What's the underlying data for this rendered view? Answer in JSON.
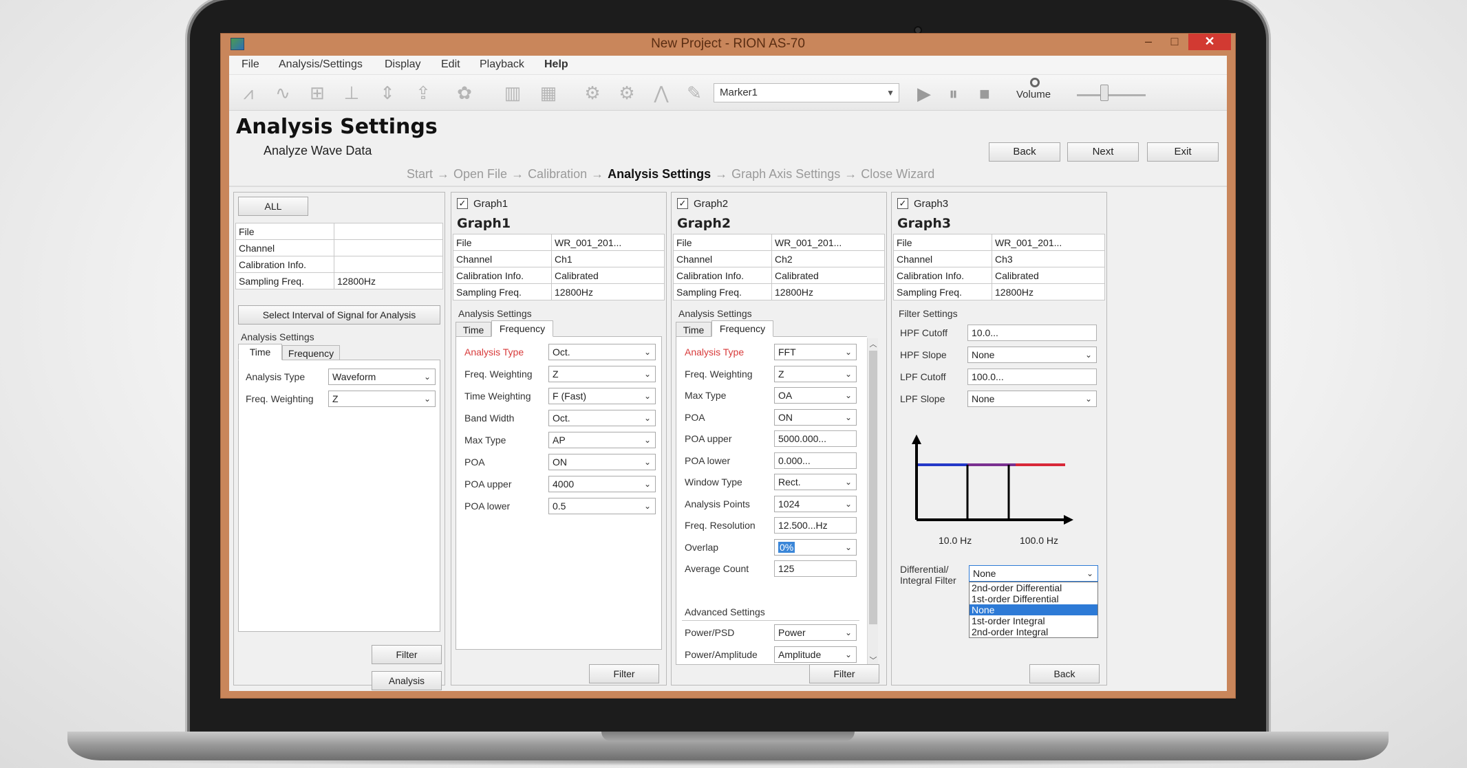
{
  "window": {
    "title": "New Project - RION AS-70",
    "minimize_glyph": "–",
    "maximize_glyph": "□",
    "close_glyph": "✕"
  },
  "menu": {
    "file": "File",
    "analysis_settings": "Analysis/Settings",
    "display": "Display",
    "edit": "Edit",
    "playback": "Playback",
    "help": "Help"
  },
  "toolbar": {
    "marker_value": "Marker1",
    "volume_label": "Volume",
    "volume_level_fraction": 0.4,
    "icons": [
      "spectrum-icon",
      "wave-icon",
      "multi-graph-icon",
      "axis-icon",
      "zoom-fit-icon",
      "export-icon",
      "settings-icon",
      "fft-icon",
      "table-icon",
      "gear-icon",
      "gear-down-icon",
      "peak-icon",
      "pen-icon"
    ]
  },
  "page": {
    "title": "Analysis Settings",
    "subtitle": "Analyze Wave Data",
    "back": "Back",
    "next": "Next",
    "exit": "Exit"
  },
  "breadcrumb": {
    "start": "Start",
    "open_file": "Open File",
    "calibration": "Calibration",
    "analysis_settings": "Analysis Settings",
    "graph_axis_settings": "Graph Axis Settings",
    "close_wizard": "Close Wizard",
    "arrow": "→"
  },
  "all_panel": {
    "all_button": "ALL",
    "rows": [
      {
        "key": "File",
        "value": ""
      },
      {
        "key": "Channel",
        "value": ""
      },
      {
        "key": "Calibration Info.",
        "value": ""
      },
      {
        "key": "Sampling Freq.",
        "value": "12800Hz"
      }
    ],
    "select_interval_button": "Select Interval of Signal for Analysis",
    "analysis_settings_label": "Analysis Settings",
    "tab_time": "Time",
    "tab_frequency": "Frequency",
    "analysis_type_label": "Analysis Type",
    "analysis_type_value": "Waveform",
    "freq_weighting_label": "Freq. Weighting",
    "freq_weighting_value": "Z",
    "filter_button": "Filter",
    "analysis_button": "Analysis"
  },
  "graph1": {
    "checkbox_label": "Graph1",
    "checked_glyph": "✓",
    "title": "Graph1",
    "rows": [
      {
        "key": "File",
        "value": "WR_001_201..."
      },
      {
        "key": "Channel",
        "value": "Ch1"
      },
      {
        "key": "Calibration Info.",
        "value": "Calibrated"
      },
      {
        "key": "Sampling Freq.",
        "value": "12800Hz"
      }
    ],
    "analysis_settings_label": "Analysis Settings",
    "tab_time": "Time",
    "tab_frequency": "Frequency",
    "fields": [
      {
        "label": "Analysis Type",
        "value": "Oct."
      },
      {
        "label": "Freq. Weighting",
        "value": "Z"
      },
      {
        "label": "Time Weighting",
        "value": "F (Fast)"
      },
      {
        "label": "Band Width",
        "value": "Oct."
      },
      {
        "label": "Max Type",
        "value": "AP"
      },
      {
        "label": "POA",
        "value": "ON"
      },
      {
        "label": "POA upper",
        "value": "4000"
      },
      {
        "label": "POA lower",
        "value": "0.5"
      }
    ],
    "filter_button": "Filter"
  },
  "graph2": {
    "checkbox_label": "Graph2",
    "checked_glyph": "✓",
    "title": "Graph2",
    "rows": [
      {
        "key": "File",
        "value": "WR_001_201..."
      },
      {
        "key": "Channel",
        "value": "Ch2"
      },
      {
        "key": "Calibration Info.",
        "value": "Calibrated"
      },
      {
        "key": "Sampling Freq.",
        "value": "12800Hz"
      }
    ],
    "analysis_settings_label": "Analysis Settings",
    "tab_time": "Time",
    "tab_frequency": "Frequency",
    "fields": [
      {
        "label": "Analysis Type",
        "value": "FFT",
        "kind": "dropdown"
      },
      {
        "label": "Freq. Weighting",
        "value": "Z",
        "kind": "dropdown"
      },
      {
        "label": "Max Type",
        "value": "OA",
        "kind": "dropdown"
      },
      {
        "label": "POA",
        "value": "ON",
        "kind": "dropdown"
      },
      {
        "label": "POA upper",
        "value": "5000.000...",
        "kind": "text"
      },
      {
        "label": "POA lower",
        "value": "0.000...",
        "kind": "text"
      },
      {
        "label": "Window Type",
        "value": "Rect.",
        "kind": "dropdown"
      },
      {
        "label": "Analysis Points",
        "value": "1024",
        "kind": "dropdown"
      },
      {
        "label": "Freq. Resolution",
        "value": "12.500...Hz",
        "kind": "text"
      },
      {
        "label": "Overlap",
        "value": "0%",
        "kind": "dropdown"
      },
      {
        "label": "Average Count",
        "value": "125",
        "kind": "text"
      }
    ],
    "advanced_label": "Advanced Settings",
    "power_psd_label": "Power/PSD",
    "power_psd_value": "Power",
    "power_amp_label": "Power/Amplitude",
    "power_amp_value": "Amplitude",
    "filter_button": "Filter"
  },
  "graph3": {
    "checkbox_label": "Graph3",
    "checked_glyph": "✓",
    "title": "Graph3",
    "rows": [
      {
        "key": "File",
        "value": "WR_001_201..."
      },
      {
        "key": "Channel",
        "value": "Ch3"
      },
      {
        "key": "Calibration Info.",
        "value": "Calibrated"
      },
      {
        "key": "Sampling Freq.",
        "value": "12800Hz"
      }
    ],
    "filter_settings_label": "Filter Settings",
    "hpf_cutoff_label": "HPF Cutoff",
    "hpf_cutoff_value": "10.0...",
    "hpf_slope_label": "HPF Slope",
    "hpf_slope_value": "None",
    "lpf_cutoff_label": "LPF Cutoff",
    "lpf_cutoff_value": "100.0...",
    "lpf_slope_label": "LPF Slope",
    "lpf_slope_value": "None",
    "chart_low_label": "10.0 Hz",
    "chart_high_label": "100.0 Hz",
    "diff_label_1": "Differential/",
    "diff_label_2": "Integral Filter",
    "diff_value": "None",
    "diff_options": [
      "2nd-order Differential",
      "1st-order Differential",
      "None",
      "1st-order Integral",
      "2nd-order Integral"
    ],
    "diff_selected_index": 2,
    "back_button": "Back"
  },
  "colors": {
    "frame": "#c9865b",
    "close_red": "#d23a32",
    "required_label": "#d83a3a",
    "filter_blue": "#2438c8",
    "filter_red": "#d82838",
    "selection": "#2d7ad6"
  }
}
